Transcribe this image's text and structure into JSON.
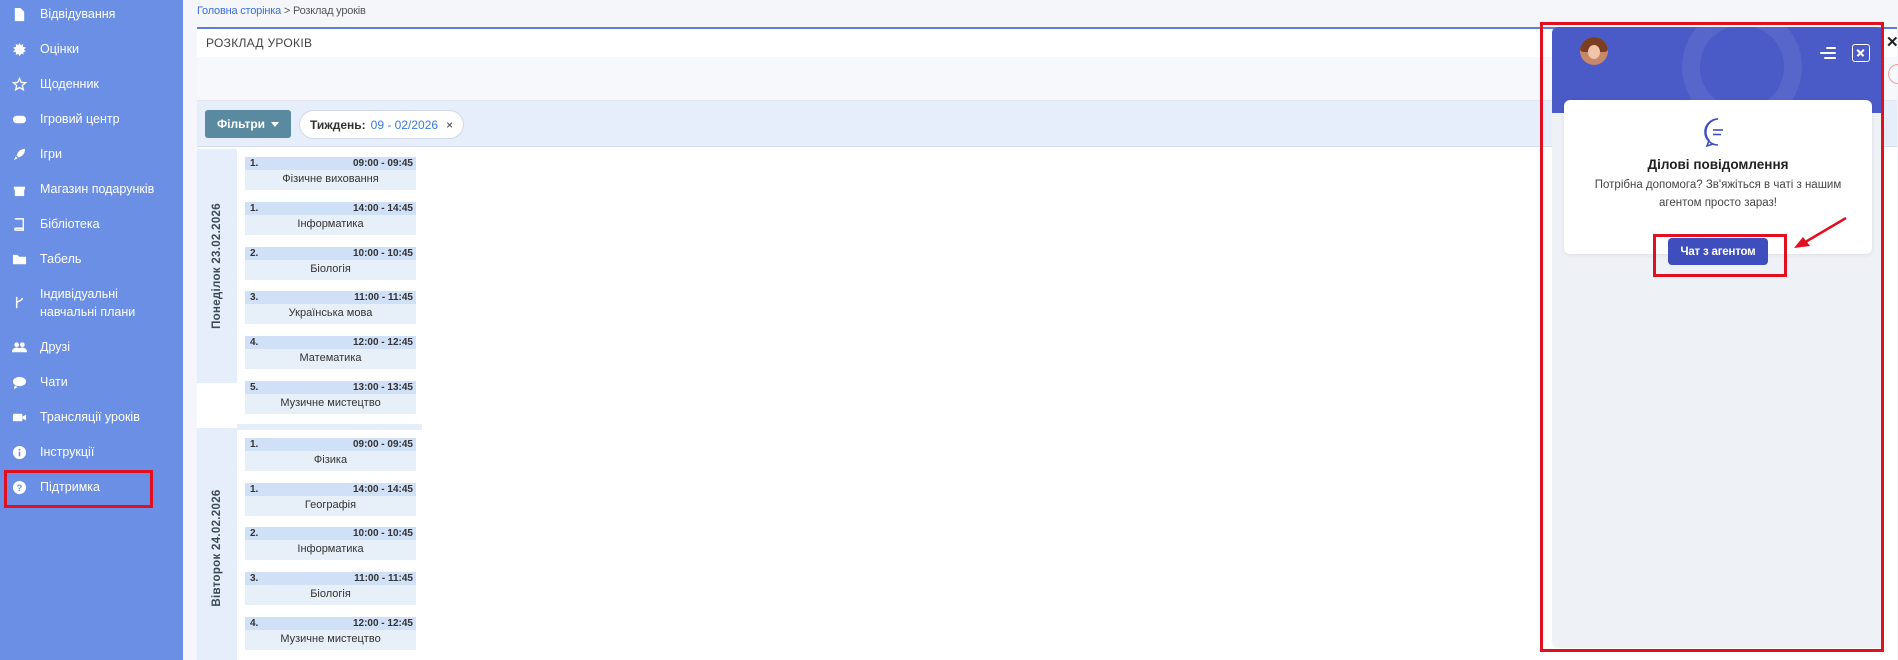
{
  "sidebar": {
    "items": [
      {
        "label": "Відвідування",
        "icon": "file-icon"
      },
      {
        "label": "Оцінки",
        "icon": "badge-icon"
      },
      {
        "label": "Щоденник",
        "icon": "star-icon"
      },
      {
        "label": "Ігровий центр",
        "icon": "gamepad-icon"
      },
      {
        "label": "Ігри",
        "icon": "rocket-icon"
      },
      {
        "label": "Магазин подарунків",
        "icon": "gift-icon"
      },
      {
        "label": "Бібліотека",
        "icon": "book-icon"
      },
      {
        "label": "Табель",
        "icon": "folder-icon"
      },
      {
        "label": "Індивідуальні",
        "label2": "навчальні плани",
        "icon": "branch-icon"
      },
      {
        "label": "Друзі",
        "icon": "users-icon"
      },
      {
        "label": "Чати",
        "icon": "chat-icon"
      },
      {
        "label": "Трансляції уроків",
        "icon": "video-icon"
      },
      {
        "label": "Інструкції",
        "icon": "info-icon"
      },
      {
        "label": "Підтримка",
        "icon": "help-icon"
      }
    ]
  },
  "breadcrumb": {
    "home": "Головна сторінка",
    "separator": " > ",
    "current": "Розклад уроків"
  },
  "panel": {
    "title": "РОЗКЛАД УРОКІВ"
  },
  "filters": {
    "button_label": "Фільтри",
    "week_label": "Тиждень:",
    "week_value": "09 - 02/2026",
    "remove": "×"
  },
  "days": [
    {
      "label": "Понеділок 23.02.2026",
      "lessons": [
        {
          "num": "1.",
          "time": "09:00 - 09:45",
          "subject": "Фізичне виховання"
        },
        {
          "num": "1.",
          "time": "14:00 - 14:45",
          "subject": "Інформатика"
        },
        {
          "num": "2.",
          "time": "10:00 - 10:45",
          "subject": "Біологія"
        },
        {
          "num": "3.",
          "time": "11:00 - 11:45",
          "subject": "Українська мова"
        },
        {
          "num": "4.",
          "time": "12:00 - 12:45",
          "subject": "Математика"
        },
        {
          "num": "5.",
          "time": "13:00 - 13:45",
          "subject": "Музичне мистецтво"
        }
      ]
    },
    {
      "label": "Вівторок 24.02.2026",
      "lessons": [
        {
          "num": "1.",
          "time": "09:00 - 09:45",
          "subject": "Фізика"
        },
        {
          "num": "1.",
          "time": "14:00 - 14:45",
          "subject": "Географія"
        },
        {
          "num": "2.",
          "time": "10:00 - 10:45",
          "subject": "Інформатика"
        },
        {
          "num": "3.",
          "time": "11:00 - 11:45",
          "subject": "Біологія"
        },
        {
          "num": "4.",
          "time": "12:00 - 12:45",
          "subject": "Музичне мистецтво"
        }
      ]
    }
  ],
  "chat": {
    "title": "Ділові повідомлення",
    "text": "Потрібна допомога? Зв'яжіться в чаті з нашим агентом просто зараз!",
    "button": "Чат з агентом"
  },
  "colors": {
    "sidebar": "#6a8fe4",
    "accent": "#4a5bc8",
    "highlight": "#e01020"
  }
}
